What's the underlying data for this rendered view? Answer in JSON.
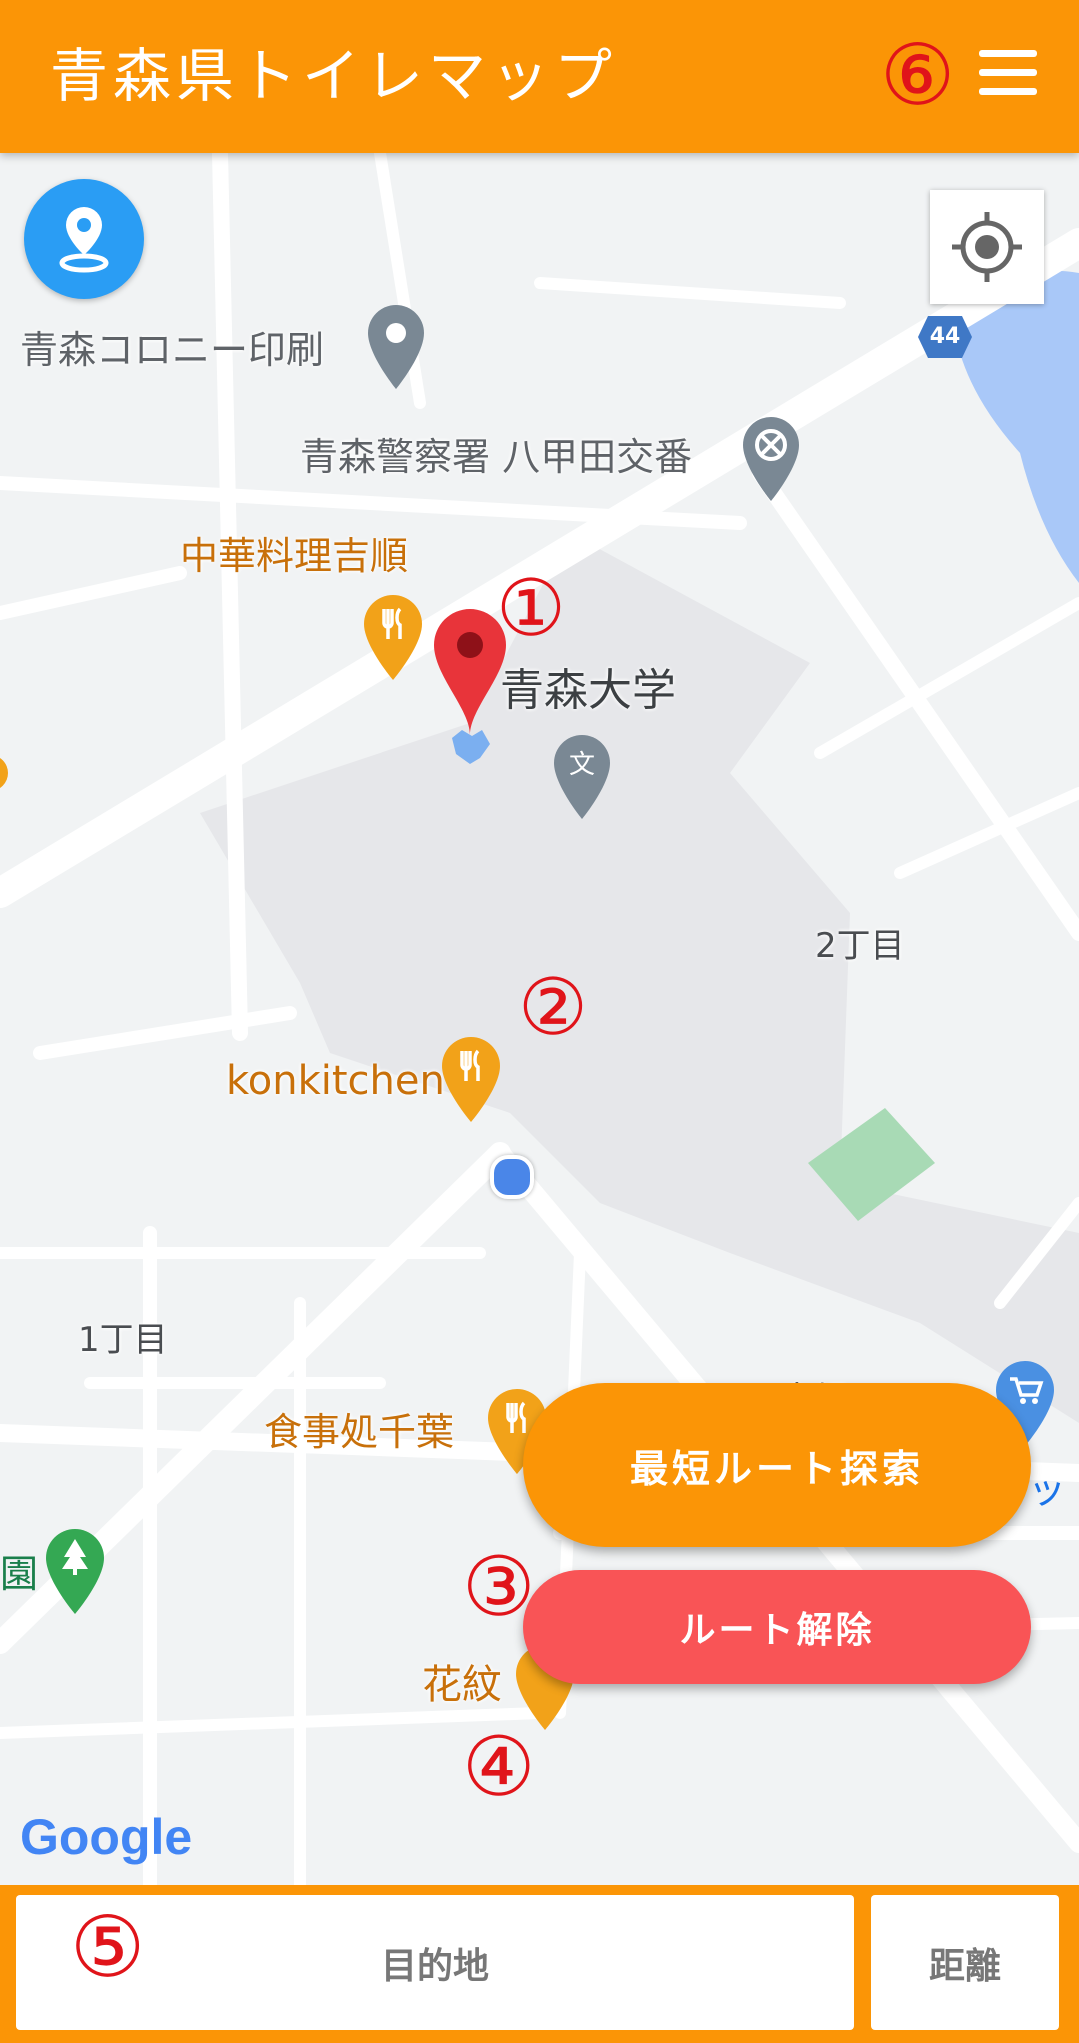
{
  "header": {
    "title": "青森県トイレマップ",
    "menu_icon": "hamburger-menu-icon"
  },
  "annotations": {
    "a1": "①",
    "a2": "②",
    "a3": "③",
    "a4": "④",
    "a5": "⑤",
    "a6": "⑥"
  },
  "map": {
    "route_badge": "44",
    "places": {
      "colony": "青森コロニー印刷",
      "police": "青森警察署 八甲田交番",
      "restaurant_kichijun": "中華料理吉順",
      "university": "青森大学",
      "konkitchen": "konkitchen",
      "shokujidokoro": "食事処千葉",
      "kamon": "花紋",
      "park_partial": "園",
      "shop_partial": "マッ"
    },
    "areas": {
      "chome2": "2丁目",
      "chome1": "1丁目",
      "saiwaibata": "幸畑"
    },
    "attribution": "Google"
  },
  "buttons": {
    "route_search": "最短ルート探索",
    "route_clear": "ルート解除"
  },
  "bottom": {
    "destination": "目的地",
    "distance": "距離"
  },
  "colors": {
    "accent": "#fb9506",
    "danger": "#f95456",
    "location_blue": "#2a9df4"
  }
}
